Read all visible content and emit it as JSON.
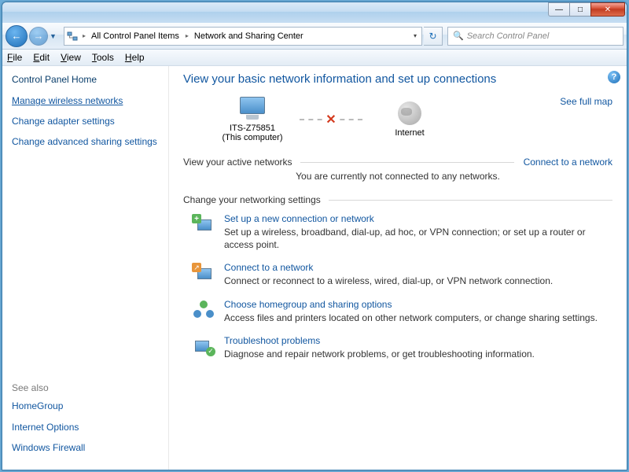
{
  "breadcrumb": {
    "parent": "All Control Panel Items",
    "current": "Network and Sharing Center"
  },
  "search": {
    "placeholder": "Search Control Panel"
  },
  "menu": {
    "file": "File",
    "edit": "Edit",
    "view": "View",
    "tools": "Tools",
    "help": "Help"
  },
  "sidebar": {
    "home": "Control Panel Home",
    "links": [
      {
        "label": "Manage wireless networks",
        "active": true
      },
      {
        "label": "Change adapter settings",
        "active": false
      },
      {
        "label": "Change advanced sharing settings",
        "active": false
      }
    ],
    "see_also_hdr": "See also",
    "see_also": [
      "HomeGroup",
      "Internet Options",
      "Windows Firewall"
    ]
  },
  "main": {
    "title": "View your basic network information and set up connections",
    "map_link": "See full map",
    "computer_name": "ITS-Z75851",
    "computer_sub": "(This computer)",
    "internet_label": "Internet",
    "active_hdr": "View your active networks",
    "connect_link": "Connect to a network",
    "no_conn_msg": "You are currently not connected to any networks.",
    "settings_hdr": "Change your networking settings",
    "options": [
      {
        "title": "Set up a new connection or network",
        "desc": "Set up a wireless, broadband, dial-up, ad hoc, or VPN connection; or set up a router or access point."
      },
      {
        "title": "Connect to a network",
        "desc": "Connect or reconnect to a wireless, wired, dial-up, or VPN network connection."
      },
      {
        "title": "Choose homegroup and sharing options",
        "desc": "Access files and printers located on other network computers, or change sharing settings."
      },
      {
        "title": "Troubleshoot problems",
        "desc": "Diagnose and repair network problems, or get troubleshooting information."
      }
    ]
  }
}
